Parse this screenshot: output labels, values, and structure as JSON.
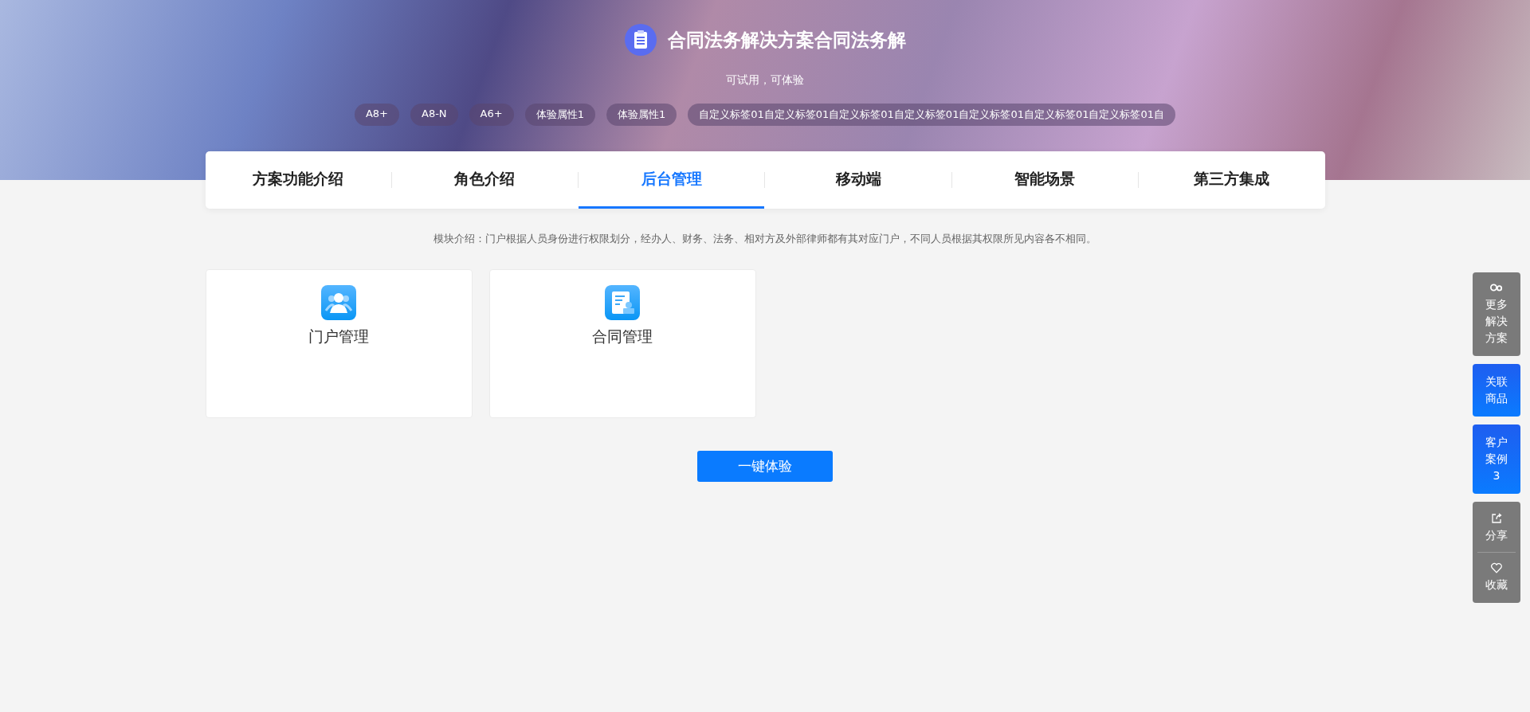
{
  "banner": {
    "title": "合同法务解决方案合同法务解",
    "subtitle": "可试用，可体验",
    "tags": [
      "A8+",
      "A8-N",
      "A6+",
      "体验属性1",
      "体验属性1",
      "自定义标签01自定义标签01自定义标签01自定义标签01自定义标签01自定义标签01自定义标签01自"
    ]
  },
  "tabs": [
    {
      "label": "方案功能介绍",
      "selected": false
    },
    {
      "label": "角色介绍",
      "selected": false
    },
    {
      "label": "后台管理",
      "selected": true
    },
    {
      "label": "移动端",
      "selected": false
    },
    {
      "label": "智能场景",
      "selected": false
    },
    {
      "label": "第三方集成",
      "selected": false
    }
  ],
  "description": "模块介绍：门户根据人员身份进行权限划分，经办人、财务、法务、相对方及外部律师都有其对应门户，不同人员根据其权限所见内容各不相同。",
  "cards": [
    {
      "label": "门户管理",
      "kind": "people"
    },
    {
      "label": "合同管理",
      "kind": "document"
    }
  ],
  "primary_button": "一键体验",
  "sidebar": [
    {
      "label": "更多解决方案",
      "kind": "more"
    },
    {
      "label": "关联商品",
      "kind": "link"
    },
    {
      "label": "客户案例",
      "count": "3",
      "kind": "link"
    }
  ],
  "share_group": [
    {
      "label": "分享",
      "kind": "share"
    },
    {
      "label": "收藏",
      "kind": "favorite"
    }
  ]
}
